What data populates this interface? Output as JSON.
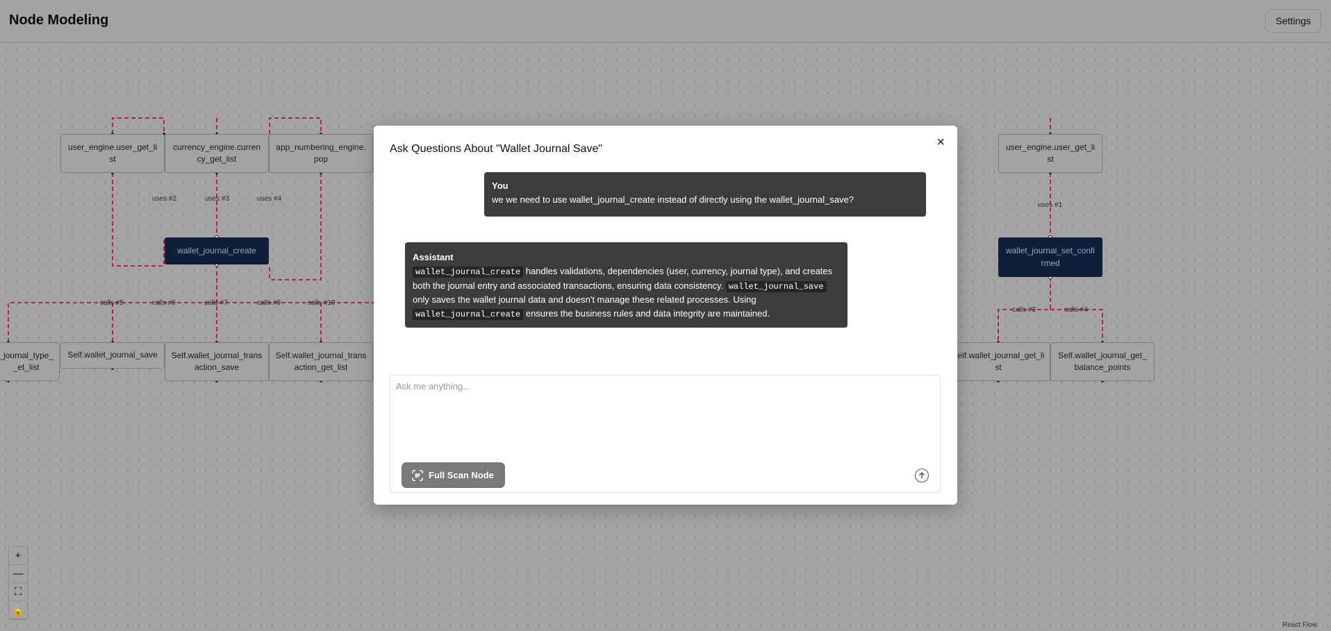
{
  "header": {
    "title": "Node Modeling",
    "settings_label": "Settings"
  },
  "nodes": {
    "n1": "user_engine.user_get_list",
    "n2": "currency_engine.currency_get_list",
    "n3": "app_numbering_engine.pop",
    "n4": "wallet_journal_create",
    "n5": "wallet_journal_type_get_list",
    "n5_visible": "_journal_type_\n_et_list",
    "n6": "Self.wallet_journal_save",
    "n7": "Self.wallet_journal_transaction_save",
    "n8": "Self.wallet_journal_transaction_get_list",
    "n9": "user_engine.user_get_list",
    "n10": "wallet_journal_set_confirmed",
    "n11": "Self.wallet_journal_get_list",
    "n11_visible": "Self.wallet_journal_get_li\nst",
    "n12": "Self.wallet_journal_get_balance_points"
  },
  "edge_labels": {
    "e_uses2": "uses #2",
    "e_uses3": "uses #3",
    "e_uses4": "uses #4",
    "e_calls5": "calls #5",
    "e_calls6": "calls #6",
    "e_calls7": "calls #7",
    "e_calls9": "calls #9",
    "e_calls10": "calls #10",
    "e_uses1": "uses #1",
    "e_calls3": "calls #3",
    "e_calls4": "calls #4"
  },
  "controls": {
    "zoom_in": "+",
    "zoom_out": "—",
    "fit": "⛶",
    "lock": "🔒"
  },
  "attribution": "React Flow",
  "modal": {
    "title": "Ask Questions About \"Wallet Journal Save\"",
    "close": "×",
    "user_msg": {
      "who": "You",
      "text": "we we need to use wallet_journal_create instead of directly using the wallet_journal_save?"
    },
    "assistant_msg": {
      "who": "Assistant",
      "code1": "wallet_journal_create",
      "t1": " handles validations, dependencies (user, currency, journal type), and creates both the journal entry and associated transactions, ensuring data consistency. ",
      "code2": "wallet_journal_save",
      "t2": " only saves the wallet journal data and doesn't manage these related processes. Using ",
      "code3": "wallet_journal_create",
      "t3": " ensures the business rules and data integrity are maintained."
    },
    "input_placeholder": "Ask me anything...",
    "scan_button": "Full Scan Node"
  }
}
